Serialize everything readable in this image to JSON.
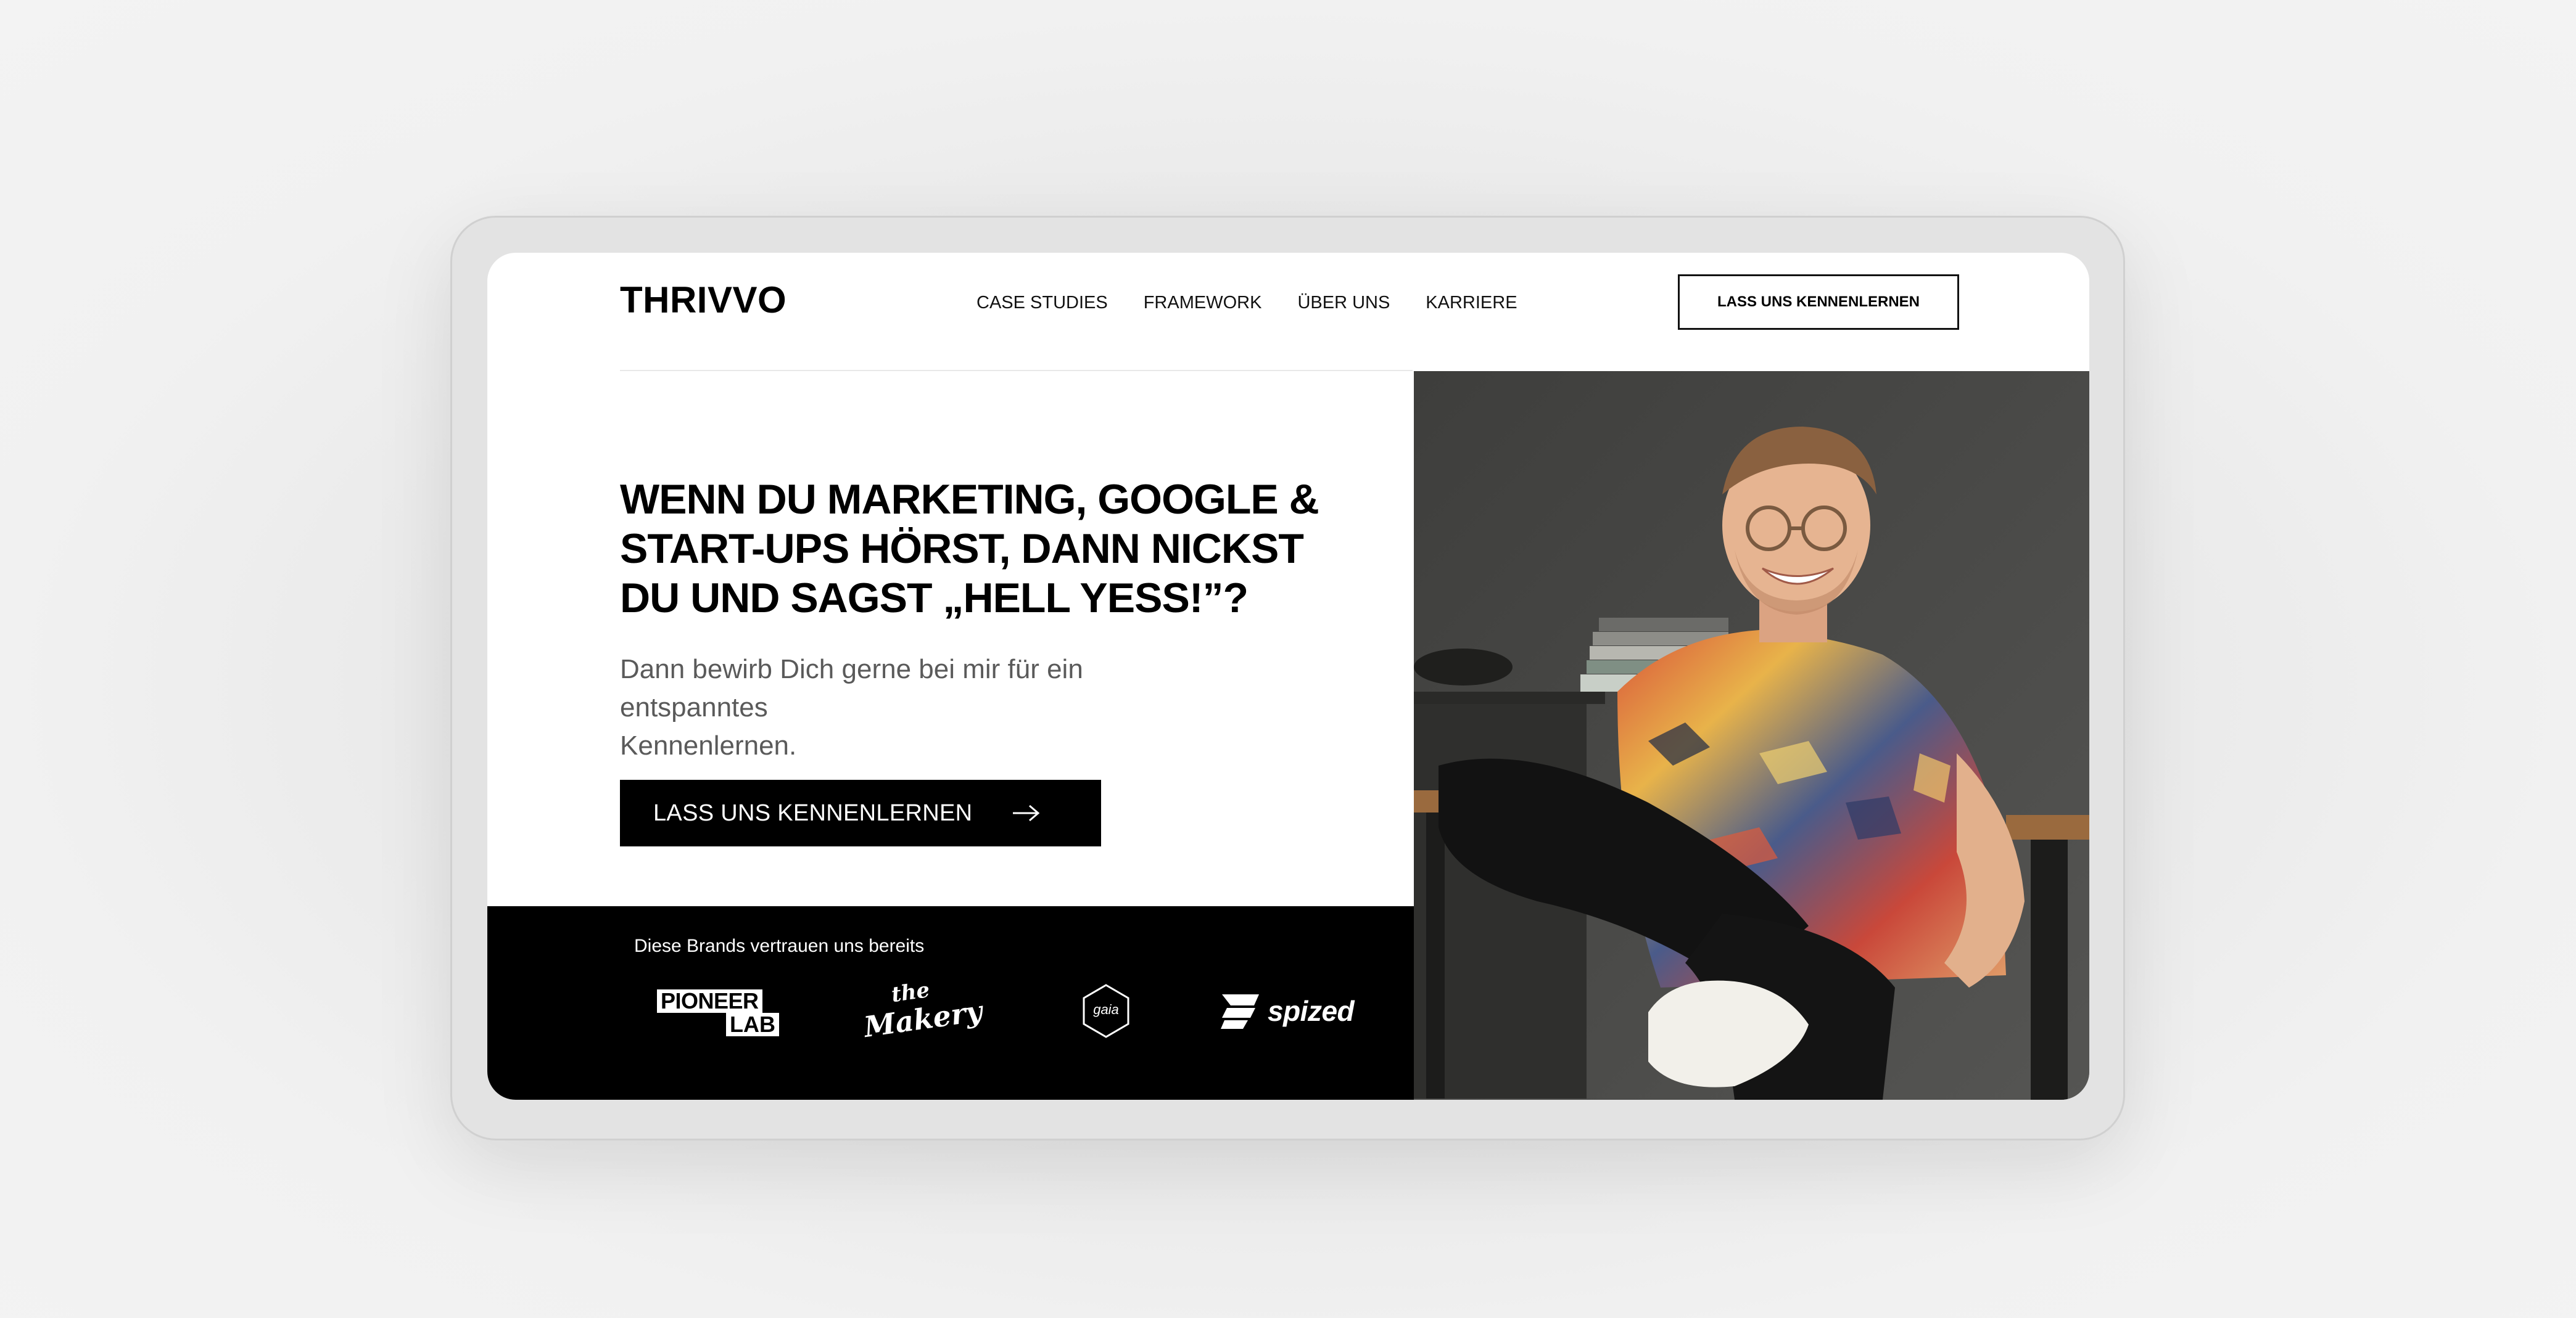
{
  "header": {
    "logo": "THRIVVO",
    "nav": [
      {
        "label": "CASE STUDIES"
      },
      {
        "label": "FRAMEWORK"
      },
      {
        "label": "ÜBER UNS"
      },
      {
        "label": "KARRIERE"
      }
    ],
    "cta_label": "LASS UNS KENNENLERNEN"
  },
  "hero": {
    "headline_lines": [
      "WENN DU MARKETING, GOOGLE &",
      "START-UPS HÖRST, DANN NICKST",
      "DU UND SAGST „HELL YESS!”?"
    ],
    "subline_lines": [
      "Dann bewirb Dich gerne bei mir für ein entspanntes",
      "Kennenlernen."
    ],
    "cta_label": "LASS UNS KENNENLERNEN",
    "cta_icon": "arrow-right-icon"
  },
  "brands": {
    "caption": "Diese Brands vertrauen uns bereits",
    "logos": [
      {
        "name": "pioneer-lab",
        "line1": "PIONEER",
        "line2": "LAB"
      },
      {
        "name": "the-makery",
        "line1": "the",
        "line2": "Makery"
      },
      {
        "name": "gaia",
        "text": "gaia"
      },
      {
        "name": "spized",
        "text": "spized"
      }
    ]
  },
  "colors": {
    "background": "#f0f0f0",
    "screen": "#ffffff",
    "brand_band": "#000000",
    "text": "#000000",
    "subtext": "#5a5a5a"
  }
}
